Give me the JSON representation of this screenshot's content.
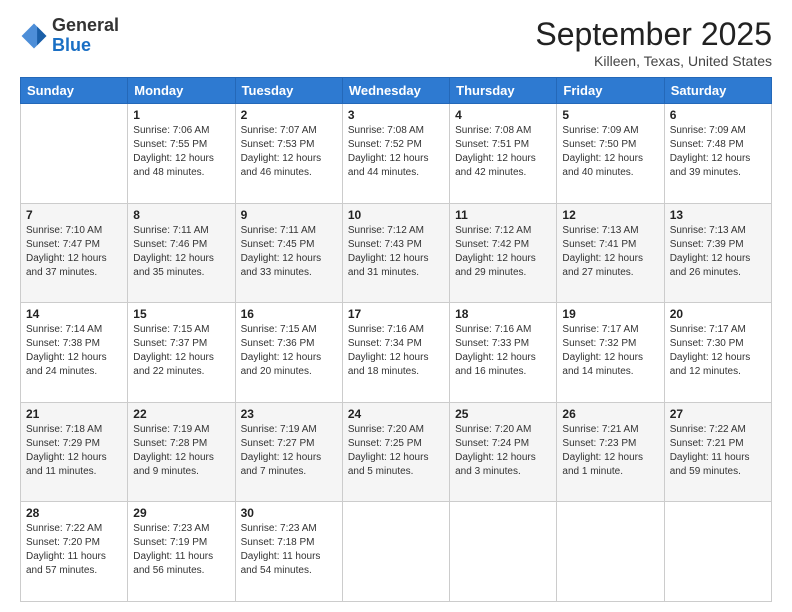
{
  "header": {
    "logo_general": "General",
    "logo_blue": "Blue",
    "month_title": "September 2025",
    "location": "Killeen, Texas, United States"
  },
  "days_of_week": [
    "Sunday",
    "Monday",
    "Tuesday",
    "Wednesday",
    "Thursday",
    "Friday",
    "Saturday"
  ],
  "weeks": [
    [
      {
        "day": "",
        "sunrise": "",
        "sunset": "",
        "daylight": ""
      },
      {
        "day": "1",
        "sunrise": "Sunrise: 7:06 AM",
        "sunset": "Sunset: 7:55 PM",
        "daylight": "Daylight: 12 hours and 48 minutes."
      },
      {
        "day": "2",
        "sunrise": "Sunrise: 7:07 AM",
        "sunset": "Sunset: 7:53 PM",
        "daylight": "Daylight: 12 hours and 46 minutes."
      },
      {
        "day": "3",
        "sunrise": "Sunrise: 7:08 AM",
        "sunset": "Sunset: 7:52 PM",
        "daylight": "Daylight: 12 hours and 44 minutes."
      },
      {
        "day": "4",
        "sunrise": "Sunrise: 7:08 AM",
        "sunset": "Sunset: 7:51 PM",
        "daylight": "Daylight: 12 hours and 42 minutes."
      },
      {
        "day": "5",
        "sunrise": "Sunrise: 7:09 AM",
        "sunset": "Sunset: 7:50 PM",
        "daylight": "Daylight: 12 hours and 40 minutes."
      },
      {
        "day": "6",
        "sunrise": "Sunrise: 7:09 AM",
        "sunset": "Sunset: 7:48 PM",
        "daylight": "Daylight: 12 hours and 39 minutes."
      }
    ],
    [
      {
        "day": "7",
        "sunrise": "Sunrise: 7:10 AM",
        "sunset": "Sunset: 7:47 PM",
        "daylight": "Daylight: 12 hours and 37 minutes."
      },
      {
        "day": "8",
        "sunrise": "Sunrise: 7:11 AM",
        "sunset": "Sunset: 7:46 PM",
        "daylight": "Daylight: 12 hours and 35 minutes."
      },
      {
        "day": "9",
        "sunrise": "Sunrise: 7:11 AM",
        "sunset": "Sunset: 7:45 PM",
        "daylight": "Daylight: 12 hours and 33 minutes."
      },
      {
        "day": "10",
        "sunrise": "Sunrise: 7:12 AM",
        "sunset": "Sunset: 7:43 PM",
        "daylight": "Daylight: 12 hours and 31 minutes."
      },
      {
        "day": "11",
        "sunrise": "Sunrise: 7:12 AM",
        "sunset": "Sunset: 7:42 PM",
        "daylight": "Daylight: 12 hours and 29 minutes."
      },
      {
        "day": "12",
        "sunrise": "Sunrise: 7:13 AM",
        "sunset": "Sunset: 7:41 PM",
        "daylight": "Daylight: 12 hours and 27 minutes."
      },
      {
        "day": "13",
        "sunrise": "Sunrise: 7:13 AM",
        "sunset": "Sunset: 7:39 PM",
        "daylight": "Daylight: 12 hours and 26 minutes."
      }
    ],
    [
      {
        "day": "14",
        "sunrise": "Sunrise: 7:14 AM",
        "sunset": "Sunset: 7:38 PM",
        "daylight": "Daylight: 12 hours and 24 minutes."
      },
      {
        "day": "15",
        "sunrise": "Sunrise: 7:15 AM",
        "sunset": "Sunset: 7:37 PM",
        "daylight": "Daylight: 12 hours and 22 minutes."
      },
      {
        "day": "16",
        "sunrise": "Sunrise: 7:15 AM",
        "sunset": "Sunset: 7:36 PM",
        "daylight": "Daylight: 12 hours and 20 minutes."
      },
      {
        "day": "17",
        "sunrise": "Sunrise: 7:16 AM",
        "sunset": "Sunset: 7:34 PM",
        "daylight": "Daylight: 12 hours and 18 minutes."
      },
      {
        "day": "18",
        "sunrise": "Sunrise: 7:16 AM",
        "sunset": "Sunset: 7:33 PM",
        "daylight": "Daylight: 12 hours and 16 minutes."
      },
      {
        "day": "19",
        "sunrise": "Sunrise: 7:17 AM",
        "sunset": "Sunset: 7:32 PM",
        "daylight": "Daylight: 12 hours and 14 minutes."
      },
      {
        "day": "20",
        "sunrise": "Sunrise: 7:17 AM",
        "sunset": "Sunset: 7:30 PM",
        "daylight": "Daylight: 12 hours and 12 minutes."
      }
    ],
    [
      {
        "day": "21",
        "sunrise": "Sunrise: 7:18 AM",
        "sunset": "Sunset: 7:29 PM",
        "daylight": "Daylight: 12 hours and 11 minutes."
      },
      {
        "day": "22",
        "sunrise": "Sunrise: 7:19 AM",
        "sunset": "Sunset: 7:28 PM",
        "daylight": "Daylight: 12 hours and 9 minutes."
      },
      {
        "day": "23",
        "sunrise": "Sunrise: 7:19 AM",
        "sunset": "Sunset: 7:27 PM",
        "daylight": "Daylight: 12 hours and 7 minutes."
      },
      {
        "day": "24",
        "sunrise": "Sunrise: 7:20 AM",
        "sunset": "Sunset: 7:25 PM",
        "daylight": "Daylight: 12 hours and 5 minutes."
      },
      {
        "day": "25",
        "sunrise": "Sunrise: 7:20 AM",
        "sunset": "Sunset: 7:24 PM",
        "daylight": "Daylight: 12 hours and 3 minutes."
      },
      {
        "day": "26",
        "sunrise": "Sunrise: 7:21 AM",
        "sunset": "Sunset: 7:23 PM",
        "daylight": "Daylight: 12 hours and 1 minute."
      },
      {
        "day": "27",
        "sunrise": "Sunrise: 7:22 AM",
        "sunset": "Sunset: 7:21 PM",
        "daylight": "Daylight: 11 hours and 59 minutes."
      }
    ],
    [
      {
        "day": "28",
        "sunrise": "Sunrise: 7:22 AM",
        "sunset": "Sunset: 7:20 PM",
        "daylight": "Daylight: 11 hours and 57 minutes."
      },
      {
        "day": "29",
        "sunrise": "Sunrise: 7:23 AM",
        "sunset": "Sunset: 7:19 PM",
        "daylight": "Daylight: 11 hours and 56 minutes."
      },
      {
        "day": "30",
        "sunrise": "Sunrise: 7:23 AM",
        "sunset": "Sunset: 7:18 PM",
        "daylight": "Daylight: 11 hours and 54 minutes."
      },
      {
        "day": "",
        "sunrise": "",
        "sunset": "",
        "daylight": ""
      },
      {
        "day": "",
        "sunrise": "",
        "sunset": "",
        "daylight": ""
      },
      {
        "day": "",
        "sunrise": "",
        "sunset": "",
        "daylight": ""
      },
      {
        "day": "",
        "sunrise": "",
        "sunset": "",
        "daylight": ""
      }
    ]
  ]
}
